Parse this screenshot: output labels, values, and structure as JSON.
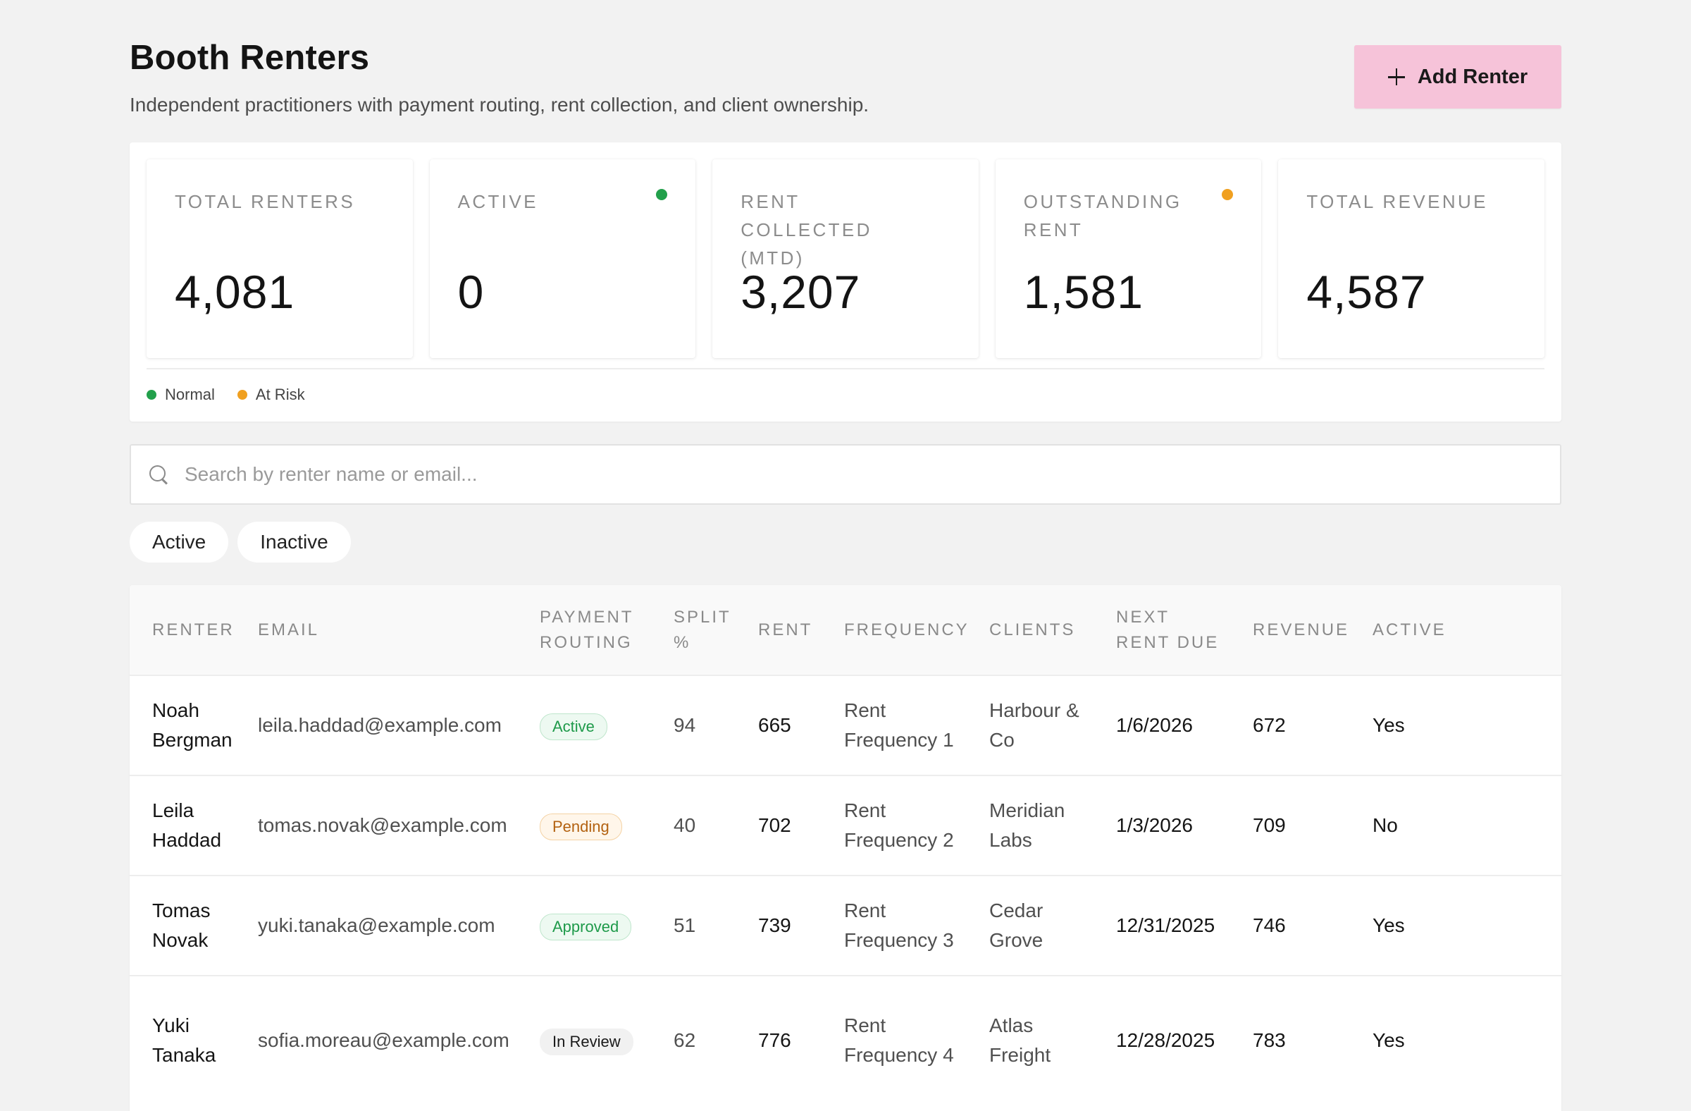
{
  "header": {
    "title": "Booth Renters",
    "subtitle": "Independent practitioners with payment routing, rent collection, and client ownership.",
    "add_button_label": "Add Renter"
  },
  "stats": [
    {
      "label": "TOTAL RENTERS",
      "value": "4,081",
      "indicator": null
    },
    {
      "label": "ACTIVE",
      "value": "0",
      "indicator": "#22a04b"
    },
    {
      "label": "RENT COLLECTED (MTD)",
      "value": "3,207",
      "indicator": null
    },
    {
      "label": "OUTSTANDING RENT",
      "value": "1,581",
      "indicator": "#f0a020"
    },
    {
      "label": "TOTAL REVENUE",
      "value": "4,587",
      "indicator": null
    }
  ],
  "legend": [
    {
      "label": "Normal",
      "color": "#22a04b"
    },
    {
      "label": "At Risk",
      "color": "#f0a020"
    }
  ],
  "search": {
    "placeholder": "Search by renter name or email...",
    "value": ""
  },
  "filters": [
    "Active",
    "Inactive"
  ],
  "table": {
    "columns": [
      "RENTER",
      "EMAIL",
      "PAYMENT ROUTING",
      "SPLIT %",
      "RENT",
      "FREQUENCY",
      "CLIENTS",
      "NEXT RENT DUE",
      "REVENUE",
      "ACTIVE"
    ],
    "rows": [
      {
        "renter": "Noah Bergman",
        "email": "leila.haddad@example.com",
        "routing": "Active",
        "routing_style": "active",
        "split": "94",
        "rent": "665",
        "frequency": "Rent Frequency 1",
        "clients": "Harbour & Co",
        "next_due": "1/6/2026",
        "revenue": "672",
        "active": "Yes"
      },
      {
        "renter": "Leila Haddad",
        "email": "tomas.novak@example.com",
        "routing": "Pending",
        "routing_style": "pending",
        "split": "40",
        "rent": "702",
        "frequency": "Rent Frequency 2",
        "clients": "Meridian Labs",
        "next_due": "1/3/2026",
        "revenue": "709",
        "active": "No"
      },
      {
        "renter": "Tomas Novak",
        "email": "yuki.tanaka@example.com",
        "routing": "Approved",
        "routing_style": "approved",
        "split": "51",
        "rent": "739",
        "frequency": "Rent Frequency 3",
        "clients": "Cedar Grove",
        "next_due": "12/31/2025",
        "revenue": "746",
        "active": "Yes"
      },
      {
        "renter": "Yuki Tanaka",
        "email": "sofia.moreau@example.com",
        "routing": "In Review",
        "routing_style": "review",
        "split": "62",
        "rent": "776",
        "frequency": "Rent Frequency 4",
        "clients": "Atlas Freight",
        "next_due": "12/28/2025",
        "revenue": "783",
        "active": "Yes"
      }
    ]
  }
}
